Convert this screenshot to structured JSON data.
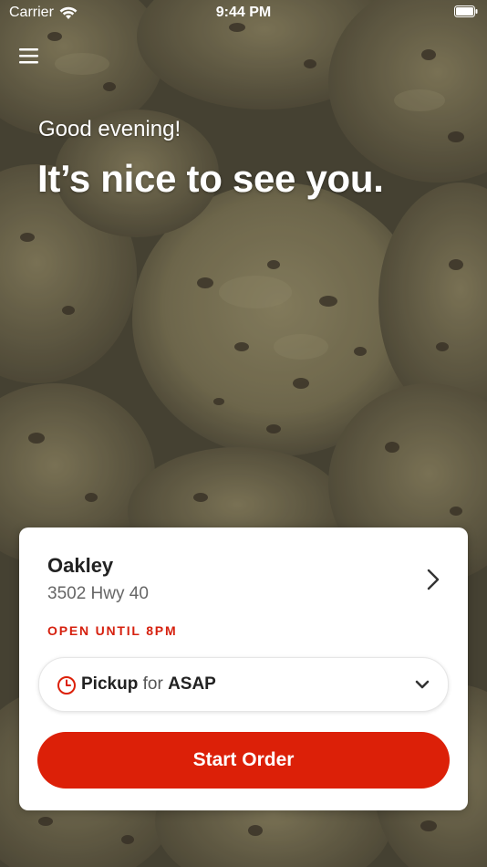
{
  "status_bar": {
    "carrier": "Carrier",
    "time": "9:44 PM"
  },
  "hero": {
    "greeting": "Good evening!",
    "headline": "It’s nice to see you."
  },
  "location": {
    "name": "Oakley",
    "address": "3502 Hwy 40",
    "hours": "OPEN UNTIL 8PM"
  },
  "order_options": {
    "mode": "Pickup",
    "connector": "for",
    "time": "ASAP"
  },
  "actions": {
    "start_order_label": "Start Order"
  },
  "icons": {
    "menu": "hamburger-menu-icon",
    "location_chevron": "chevron-right-icon",
    "clock": "clock-icon",
    "dropdown": "chevron-down-icon",
    "wifi": "wifi-icon",
    "battery": "battery-icon"
  },
  "colors": {
    "accent": "#dc2008",
    "hours_text": "#d6200e",
    "card_background": "#ffffff",
    "headline_text": "#ffffff"
  }
}
